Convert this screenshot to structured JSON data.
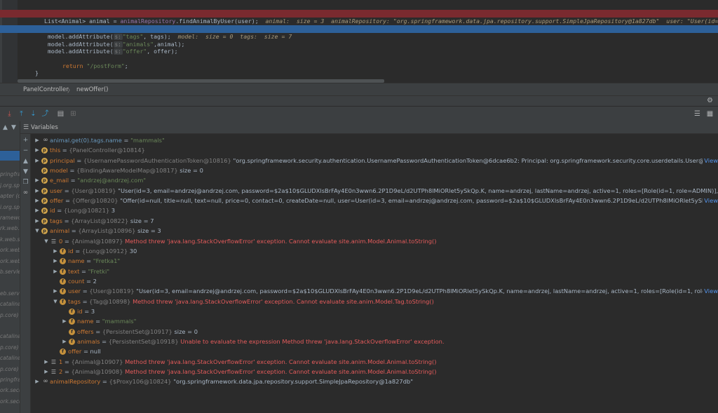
{
  "editor": {
    "line1": {
      "code_a": "List<Animal> animal = ",
      "field": "animalRepository",
      "code_b": ".findAnimalByUser(user);",
      "inline": "animal:  size = 3  animalRepository: \"org.springframework.data.jpa.repository.support.SimpleJpaRepository@1a827db\"  user: \"User(id=3, em"
    },
    "line2": {
      "code_a": "model.addAttribute(",
      "hint": "s:",
      "str": "\"tags\"",
      "code_b": ", tags);",
      "inline": "model:  size = 0  tags:  size = 7"
    },
    "line3": {
      "code_a": "model.addAttribute(",
      "hint": "s:",
      "str": "\"animals\"",
      "code_b": ",animal);"
    },
    "line4": {
      "code_a": "model.addAttribute(",
      "hint": "s:",
      "str": "\"offer\"",
      "code_b": ", offer);"
    },
    "line5": {
      "kw": "return",
      "str": "\"/postForm\"",
      "code_b": ";"
    },
    "line6": {
      "code_a": "}"
    }
  },
  "breadcrumb": {
    "class_name": "PanelController",
    "method_name": "newOffer()"
  },
  "variables_panel": {
    "title": "Variables"
  },
  "frames": [
    "",
    "pringfram",
    "j.org.sp",
    "apter (o",
    "i.org.sprin",
    "ramework",
    "rk.web.se",
    "k.web.se",
    "ork.web.se",
    "ork.web.w",
    "b.servlet)",
    "",
    "eb.servlet",
    "catalina",
    "p.core)",
    "",
    "catalina.",
    "p.core)",
    "catalina.",
    "p.core)",
    "pringfram",
    "ork.securi",
    "ork.securi"
  ],
  "tree": [
    {
      "indent": 0,
      "icon": "infinity",
      "arrow": "collapsed",
      "name": "animal.get(0).tags.name",
      "watch": true,
      "value_str": "\"mammals\""
    },
    {
      "indent": 0,
      "icon": "p",
      "arrow": "collapsed",
      "name": "this",
      "type": "{PanelController@10814}"
    },
    {
      "indent": 0,
      "icon": "p",
      "arrow": "collapsed",
      "name": "principal",
      "type": "{UsernamePasswordAuthenticationToken@10816}",
      "value": "\"org.springframework.security.authentication.UsernamePasswordAuthenticationToken@6dcae6b2: Principal: org.springframework.security.core.userdetails.User@6e7e78db: Usernam...",
      "more": "View"
    },
    {
      "indent": 0,
      "icon": "p",
      "arrow": "none",
      "name": "model",
      "type": "{BindingAwareModelMap@10817}",
      "value": "size = 0"
    },
    {
      "indent": 0,
      "icon": "p",
      "arrow": "collapsed",
      "name": "e_mail",
      "value_str": "\"andrzej@andrzej.com\""
    },
    {
      "indent": 0,
      "icon": "p",
      "arrow": "collapsed",
      "name": "user",
      "type": "{User@10819}",
      "value": "\"User(id=3, email=andrzej@andrzej.com, password=$2a$10$GLUDXlsBrFAy4E0n3wwn6.2P1D9eL/d2UTPh8lMiORlet5ySkQp.K, name=andrzej, lastName=andrzej, active=1, roles=[Role(id=1, role=ADMIN)], offers=[], Animal=[])\""
    },
    {
      "indent": 0,
      "icon": "p",
      "arrow": "collapsed",
      "name": "offer",
      "type": "{Offer@10820}",
      "value": "\"Offer(id=null, title=null, text=null, price=0, contact=0, createDate=null, user=User(id=3, email=andrzej@andrzej.com, password=$2a$10$GLUDXlsBrFAy4E0n3wwn6.2P1D9eL/d2UTPh8lMiORlet5ySkQp.K, name=andrzej, lastN...",
      "more": "View"
    },
    {
      "indent": 0,
      "icon": "p",
      "arrow": "collapsed",
      "name": "id",
      "type": "{Long@10821}",
      "value": "3"
    },
    {
      "indent": 0,
      "icon": "p",
      "arrow": "collapsed",
      "name": "tags",
      "type": "{ArrayList@10822}",
      "value": "size = 7"
    },
    {
      "indent": 0,
      "icon": "p",
      "arrow": "expanded",
      "name": "animal",
      "type": "{ArrayList@10896}",
      "value": "size = 3"
    },
    {
      "indent": 1,
      "icon": "array",
      "arrow": "expanded",
      "name": "0",
      "type": "{Animal@10897}",
      "error": "Method threw 'java.lang.StackOverflowError' exception. Cannot evaluate site.anim.Model.Animal.toString()"
    },
    {
      "indent": 2,
      "icon": "f",
      "arrow": "collapsed",
      "name": "id",
      "type": "{Long@10912}",
      "value": "30"
    },
    {
      "indent": 2,
      "icon": "f",
      "arrow": "collapsed",
      "name": "name",
      "value_str": "\"Fretka1\""
    },
    {
      "indent": 2,
      "icon": "f",
      "arrow": "collapsed",
      "name": "text",
      "value_str": "\"Fretki\""
    },
    {
      "indent": 2,
      "icon": "f",
      "arrow": "none",
      "name": "count",
      "value": "2"
    },
    {
      "indent": 2,
      "icon": "f",
      "arrow": "collapsed",
      "name": "user",
      "type": "{User@10819}",
      "value": "\"User(id=3, email=andrzej@andrzej.com, password=$2a$10$GLUDXlsBrFAy4E0n3wwn6.2P1D9eL/d2UTPh8lMiORlet5ySkQp.K, name=andrzej, lastName=andrzej, active=1, roles=[Role(id=1, role=ADMIN)], offers=[], Animal=[...",
      "more": "View"
    },
    {
      "indent": 2,
      "icon": "f",
      "arrow": "expanded",
      "name": "tags",
      "type": "{Tag@10898}",
      "error": "Method threw 'java.lang.StackOverflowError' exception. Cannot evaluate site.anim.Model.Tag.toString()"
    },
    {
      "indent": 3,
      "icon": "f",
      "arrow": "none",
      "name": "id",
      "value": "3"
    },
    {
      "indent": 3,
      "icon": "f",
      "arrow": "collapsed",
      "name": "name",
      "value_str": "\"mammals\""
    },
    {
      "indent": 3,
      "icon": "f",
      "arrow": "none",
      "name": "offers",
      "type": "{PersistentSet@10917}",
      "value": "size = 0"
    },
    {
      "indent": 3,
      "icon": "f",
      "arrow": "collapsed",
      "name": "animals",
      "type": "{PersistentSet@10918}",
      "error": "Unable to evaluate the expression Method threw 'java.lang.StackOverflowError' exception."
    },
    {
      "indent": 2,
      "icon": "f",
      "arrow": "none",
      "name": "offer",
      "value": "null"
    },
    {
      "indent": 1,
      "icon": "array",
      "arrow": "collapsed",
      "name": "1",
      "type": "{Animal@10907}",
      "error": "Method threw 'java.lang.StackOverflowError' exception. Cannot evaluate site.anim.Model.Animal.toString()"
    },
    {
      "indent": 1,
      "icon": "array",
      "arrow": "collapsed",
      "name": "2",
      "type": "{Animal@10908}",
      "error": "Method threw 'java.lang.StackOverflowError' exception. Cannot evaluate site.anim.Model.Animal.toString()"
    },
    {
      "indent": 0,
      "icon": "infinity",
      "arrow": "collapsed",
      "name": "animalRepository",
      "type": "{$Proxy106@10824}",
      "value": "\"org.springframework.data.jpa.repository.support.SimpleJpaRepository@1a827db\""
    }
  ]
}
